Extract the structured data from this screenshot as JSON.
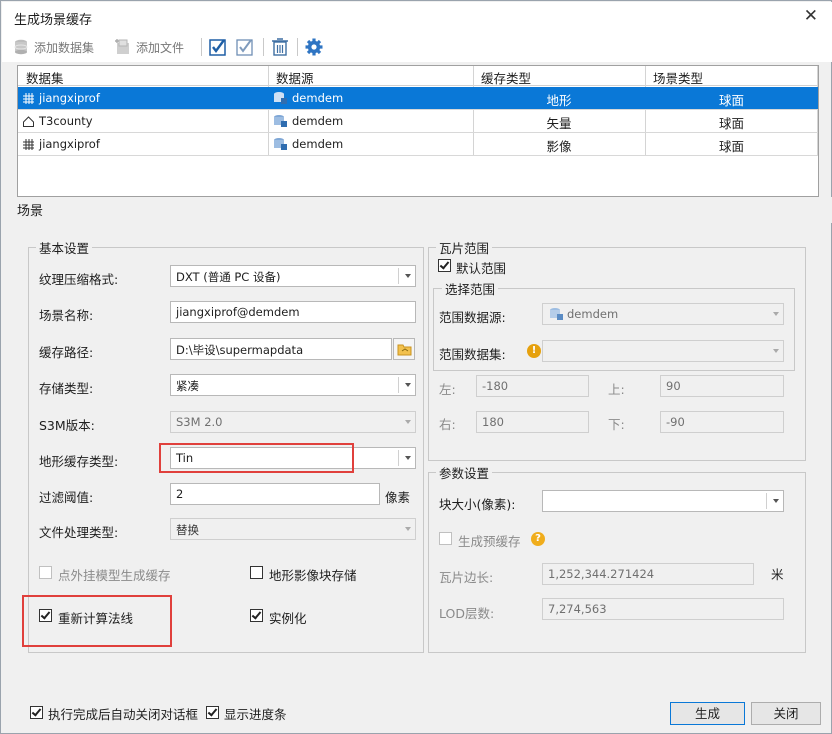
{
  "window": {
    "title": "生成场景缓存",
    "close_glyph": "✕"
  },
  "toolbar": {
    "add_dataset": "添加数据集",
    "add_file": "添加文件"
  },
  "grid": {
    "headers": [
      "数据集",
      "数据源",
      "缓存类型",
      "场景类型"
    ],
    "rows": [
      {
        "dataset": "jiangxiprof",
        "datasource": "demdem",
        "cache_type": "地形",
        "scene_type": "球面",
        "dataset_icon": "grid-dataset-icon",
        "selected": true
      },
      {
        "dataset": "T3county",
        "datasource": "demdem",
        "cache_type": "矢量",
        "scene_type": "球面",
        "dataset_icon": "region-dataset-icon",
        "selected": false
      },
      {
        "dataset": "jiangxiprof",
        "datasource": "demdem",
        "cache_type": "影像",
        "scene_type": "球面",
        "dataset_icon": "grid-dataset-icon",
        "selected": false
      }
    ]
  },
  "tab": {
    "label": "场景"
  },
  "basic": {
    "title": "基本设置",
    "texture_label": "纹理压缩格式:",
    "texture_value": "DXT (普通 PC 设备)",
    "scene_name_label": "场景名称:",
    "scene_name_value": "jiangxiprof@demdem",
    "cache_path_label": "缓存路径:",
    "cache_path_value": "D:\\毕设\\supermapdata",
    "storage_label": "存储类型:",
    "storage_value": "紧凑",
    "s3m_label": "S3M版本:",
    "s3m_value": "S3M 2.0",
    "terrain_type_label": "地形缓存类型:",
    "terrain_type_value": "Tin",
    "filter_label": "过滤阈值:",
    "filter_value": "2",
    "filter_unit": "像素",
    "file_proc_label": "文件处理类型:",
    "file_proc_value": "替换",
    "point_model_label": "点外挂模型生成缓存",
    "terrain_block_label": "地形影像块存储",
    "recalc_normals_label": "重新计算法线",
    "instancing_label": "实例化"
  },
  "tile_range": {
    "title": "瓦片范围",
    "default_range_label": "默认范围",
    "select_range_title": "选择范围",
    "range_ds_label": "范围数据源:",
    "range_ds_value": "demdem",
    "range_dataset_label": "范围数据集:",
    "left_label": "左:",
    "left_value": "-180",
    "top_label": "上:",
    "top_value": "90",
    "right_label": "右:",
    "right_value": "180",
    "bottom_label": "下:",
    "bottom_value": "-90"
  },
  "params": {
    "title": "参数设置",
    "block_size_label": "块大小(像素):",
    "block_size_value": "",
    "pre_cache_label": "生成预缓存",
    "tile_edge_label": "瓦片边长:",
    "tile_edge_value": "1,252,344.271424",
    "tile_edge_unit": "米",
    "lod_label": "LOD层数:",
    "lod_value": "7,274,563"
  },
  "footer": {
    "auto_close_label": "执行完成后自动关闭对话框",
    "progress_label": "显示进度条",
    "generate_button": "生成",
    "close_button": "关闭"
  }
}
